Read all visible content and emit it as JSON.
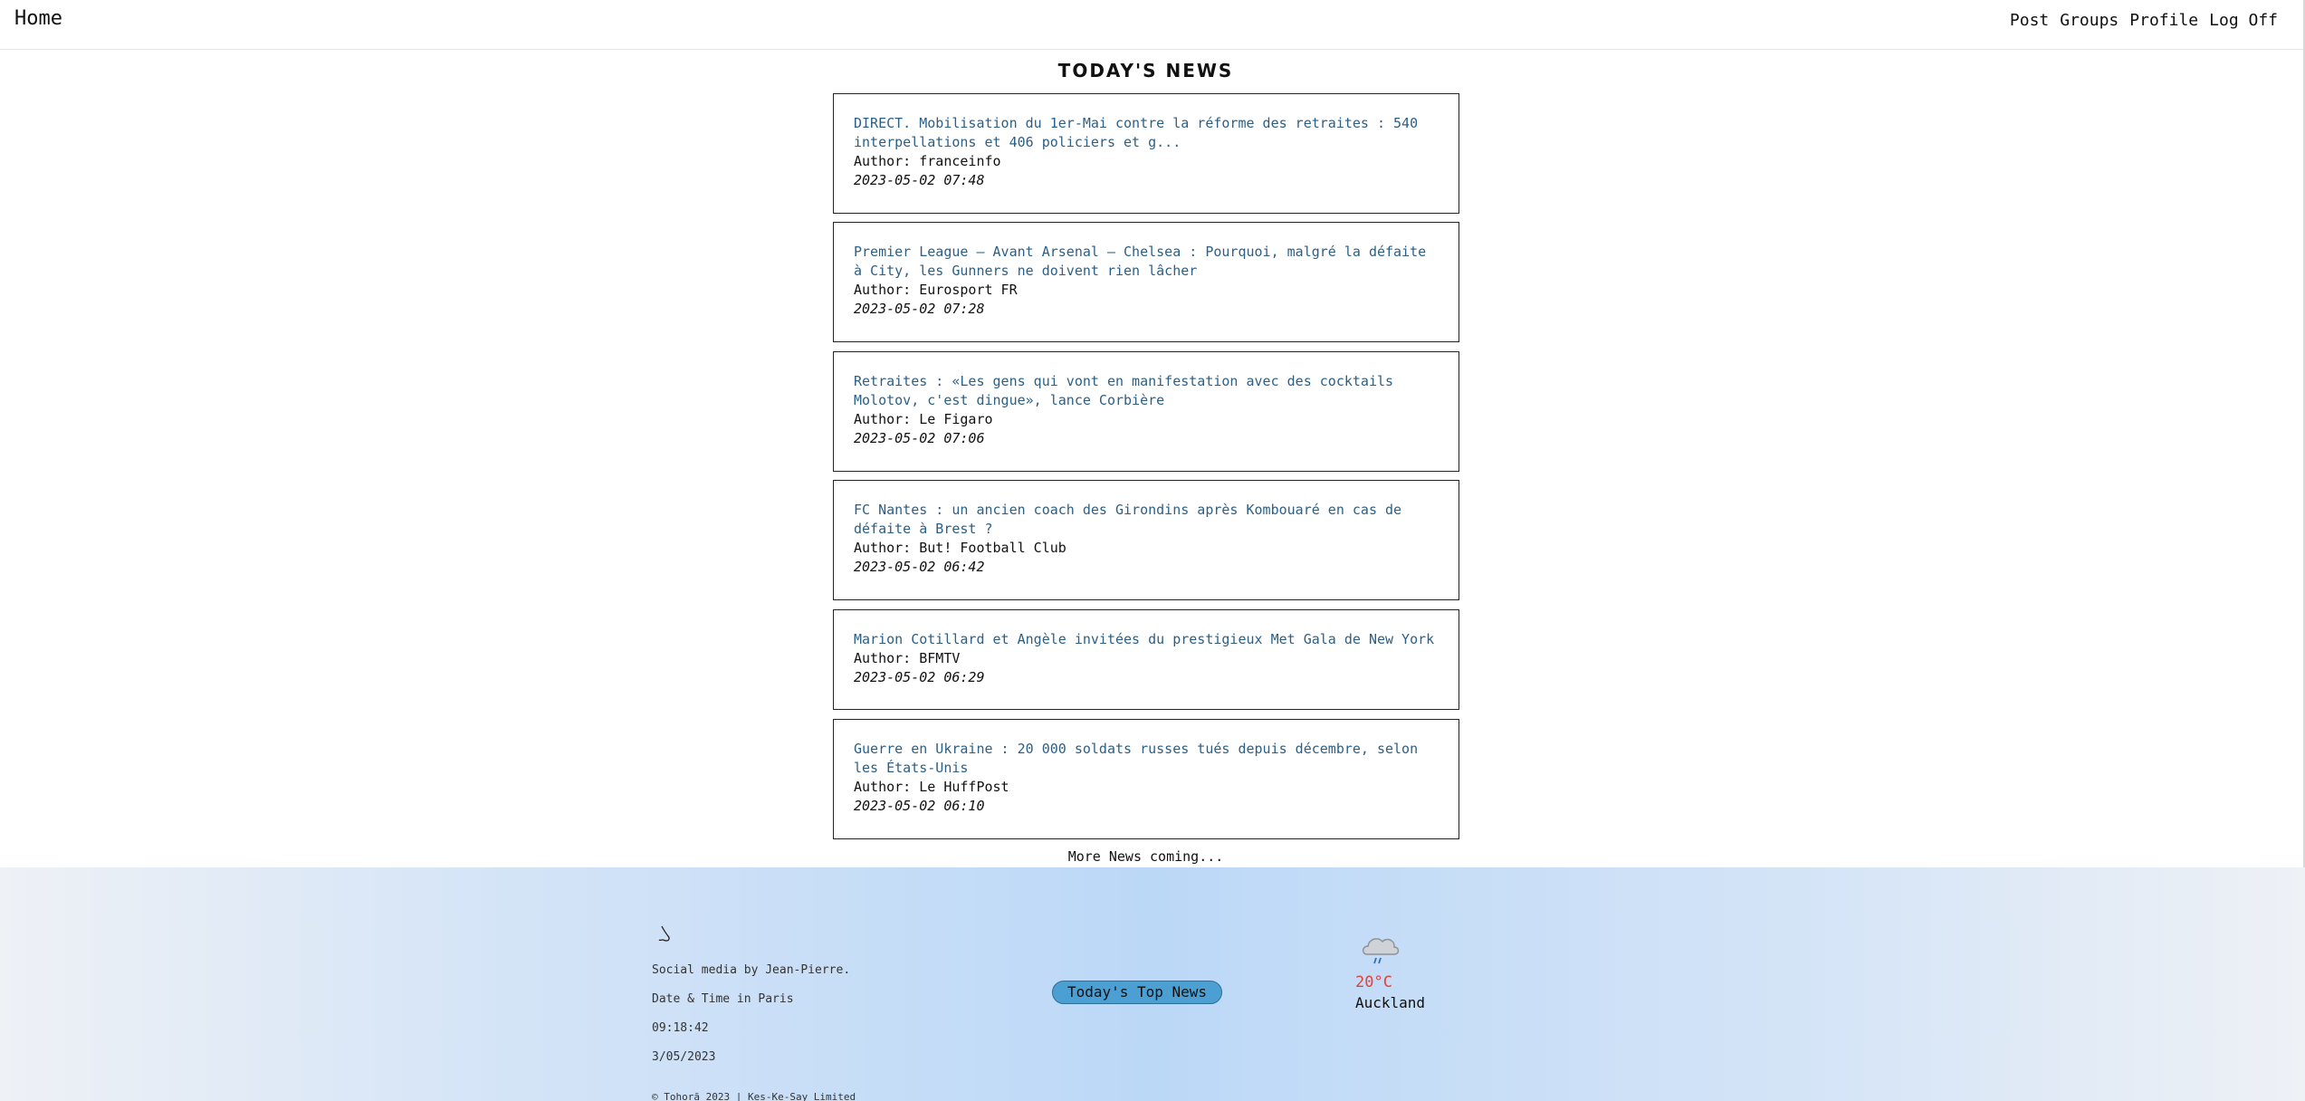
{
  "nav": {
    "home": "Home",
    "links": [
      "Post",
      "Groups",
      "Profile",
      "Log Off"
    ]
  },
  "page": {
    "title": "TODAY'S NEWS",
    "more": "More News coming..."
  },
  "news": [
    {
      "title": "DIRECT. Mobilisation du 1er-Mai contre la réforme des retraites : 540 interpellations et 406 policiers et g...",
      "author": "Author: franceinfo",
      "date": "2023-05-02 07:48"
    },
    {
      "title": "Premier League – Avant Arsenal – Chelsea : Pourquoi, malgré la défaite à City, les Gunners ne doivent rien lâcher",
      "author": "Author: Eurosport FR",
      "date": "2023-05-02 07:28"
    },
    {
      "title": "Retraites : «Les gens qui vont en manifestation avec des cocktails Molotov, c'est dingue», lance Corbière",
      "author": "Author: Le Figaro",
      "date": "2023-05-02 07:06"
    },
    {
      "title": "FC Nantes : un ancien coach des Girondins après Kombouaré en cas de défaite à Brest ?",
      "author": "Author: But! Football Club",
      "date": "2023-05-02 06:42"
    },
    {
      "title": "Marion Cotillard et Angèle invitées du prestigieux Met Gala de New York",
      "author": "Author: BFMTV",
      "date": "2023-05-02 06:29"
    },
    {
      "title": "Guerre en Ukraine : 20 000 soldats russes tués depuis décembre, selon les États-Unis",
      "author": "Author: Le HuffPost",
      "date": "2023-05-02 06:10"
    }
  ],
  "footer": {
    "icon": "nose-icon",
    "credit": "Social media by Jean-Pierre.",
    "datetime_label": "Date & Time in Paris",
    "time": "09:18:42",
    "date": "3/05/2023",
    "top_news_button": "Today's Top News",
    "weather": {
      "icon": "rain-cloud-icon",
      "temp": "20°C",
      "city": "Auckland"
    },
    "copyright": "© Tohorā 2023 | Kes-Ke-Say Limited"
  },
  "colors": {
    "link": "#2b5f86",
    "button": "#4b9fd3",
    "temp": "#e0433c"
  }
}
